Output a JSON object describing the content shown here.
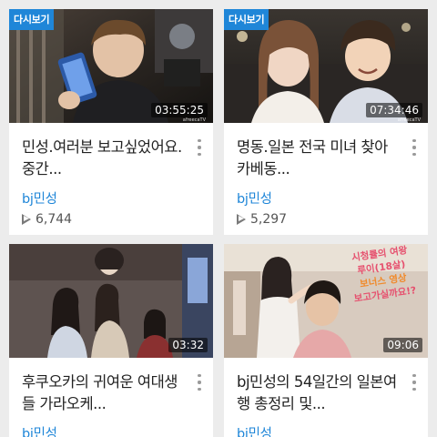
{
  "colors": {
    "accent": "#1f86d8",
    "background": "#ececec"
  },
  "videos": [
    {
      "badge": "다시보기",
      "duration": "03:55:25",
      "watermark": "afreecaTV",
      "title": "민성.여러분 보고싶었어요.중간...",
      "channel": "bj민성",
      "views": "6,744"
    },
    {
      "badge": "다시보기",
      "duration": "07:34:46",
      "watermark": "afreecaTV",
      "title": "명동.일본 전국 미녀 찾아 카베동...",
      "channel": "bj민성",
      "views": "5,297"
    },
    {
      "duration": "03:32",
      "title": "후쿠오카의 귀여운 여대생들 가라오케...",
      "channel": "bj민성"
    },
    {
      "duration": "09:06",
      "title": "bj민성의 54일간의 일본여행 총정리 및...",
      "channel": "bj민성",
      "thumb_caption": [
        "시청률의 여왕",
        "루이(18살)",
        "보너스 영상",
        "보고가실까요!?"
      ]
    }
  ]
}
